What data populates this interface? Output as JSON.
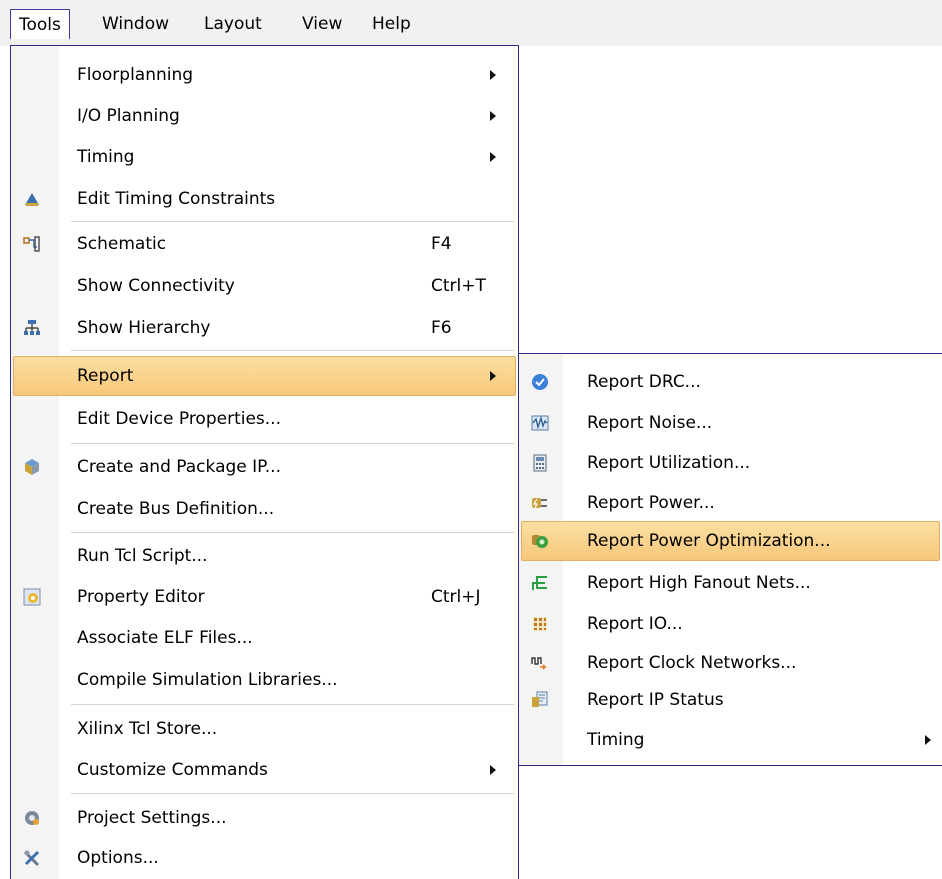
{
  "menubar": {
    "items": [
      {
        "label": "Tools"
      },
      {
        "label": "Window"
      },
      {
        "label": "Layout"
      },
      {
        "label": "View"
      },
      {
        "label": "Help"
      }
    ]
  },
  "tools_menu": {
    "items": [
      {
        "label": "Floorplanning",
        "has_submenu": true
      },
      {
        "label": "I/O Planning",
        "has_submenu": true
      },
      {
        "label": "Timing",
        "has_submenu": true
      },
      {
        "label": "Edit Timing Constraints",
        "icon": "timing-constraints-icon"
      },
      {
        "label": "Schematic",
        "shortcut": "F4",
        "icon": "schematic-icon"
      },
      {
        "label": "Show Connectivity",
        "shortcut": "Ctrl+T"
      },
      {
        "label": "Show Hierarchy",
        "shortcut": "F6",
        "icon": "hierarchy-icon"
      },
      {
        "label": "Report",
        "has_submenu": true,
        "highlighted": true
      },
      {
        "label": "Edit Device Properties..."
      },
      {
        "label": "Create and Package IP...",
        "icon": "package-ip-icon"
      },
      {
        "label": "Create Bus Definition..."
      },
      {
        "label": "Run Tcl Script..."
      },
      {
        "label": "Property Editor",
        "shortcut": "Ctrl+J",
        "icon": "property-editor-icon"
      },
      {
        "label": "Associate ELF Files..."
      },
      {
        "label": "Compile Simulation Libraries..."
      },
      {
        "label": "Xilinx Tcl Store..."
      },
      {
        "label": "Customize Commands",
        "has_submenu": true
      },
      {
        "label": "Project Settings...",
        "icon": "project-settings-icon"
      },
      {
        "label": "Options...",
        "icon": "options-icon"
      }
    ]
  },
  "report_submenu": {
    "items": [
      {
        "label": "Report DRC...",
        "icon": "drc-check-icon"
      },
      {
        "label": "Report Noise...",
        "icon": "noise-icon"
      },
      {
        "label": "Report Utilization...",
        "icon": "utilization-icon"
      },
      {
        "label": "Report Power...",
        "icon": "power-icon"
      },
      {
        "label": "Report Power Optimization...",
        "icon": "power-optimization-icon",
        "highlighted": true
      },
      {
        "label": "Report High Fanout Nets...",
        "icon": "fanout-nets-icon"
      },
      {
        "label": "Report IO...",
        "icon": "io-icon"
      },
      {
        "label": "Report Clock Networks...",
        "icon": "clock-networks-icon"
      },
      {
        "label": "Report IP Status",
        "icon": "ip-status-icon"
      },
      {
        "label": "Timing",
        "has_submenu": true
      }
    ]
  },
  "colors": {
    "menu_border": "#2a2a82",
    "highlight": "#f7c77a",
    "menubar_bg": "#f1f1f1"
  }
}
